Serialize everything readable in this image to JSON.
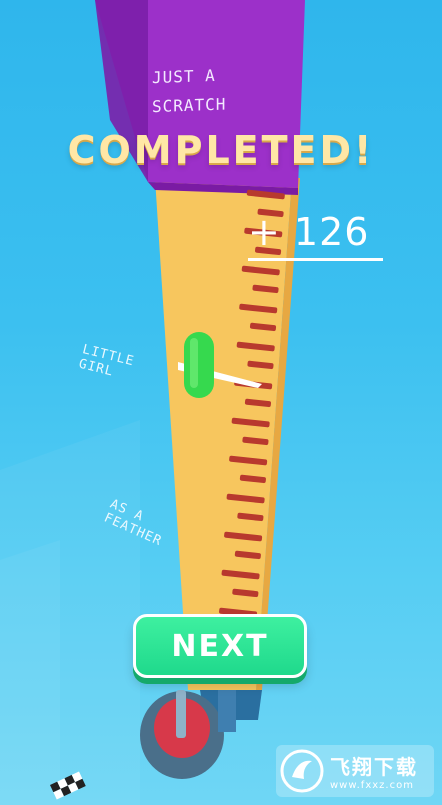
{
  "game": {
    "status_text": "COMPLETED!",
    "score_gain": "+ 126",
    "next_button_label": "NEXT"
  },
  "ruler_labels": {
    "top_line1": "JUST A",
    "top_line2": "SCRATCH",
    "mid_line1": "LITTLE",
    "mid_line2": "GIRL",
    "low_line1": "AS A",
    "low_line2": "FEATHER"
  },
  "watermark": {
    "main": "飞翔下载",
    "sub": "www.fxxz.com"
  },
  "colors": {
    "sky": "#35bbee",
    "purple_block": "#9b2fc7",
    "ruler": "#f6c35c",
    "tick": "#b83a2e",
    "pill": "#33d94a",
    "next_button": "#22de90",
    "completed_text": "#ffe7a6"
  }
}
